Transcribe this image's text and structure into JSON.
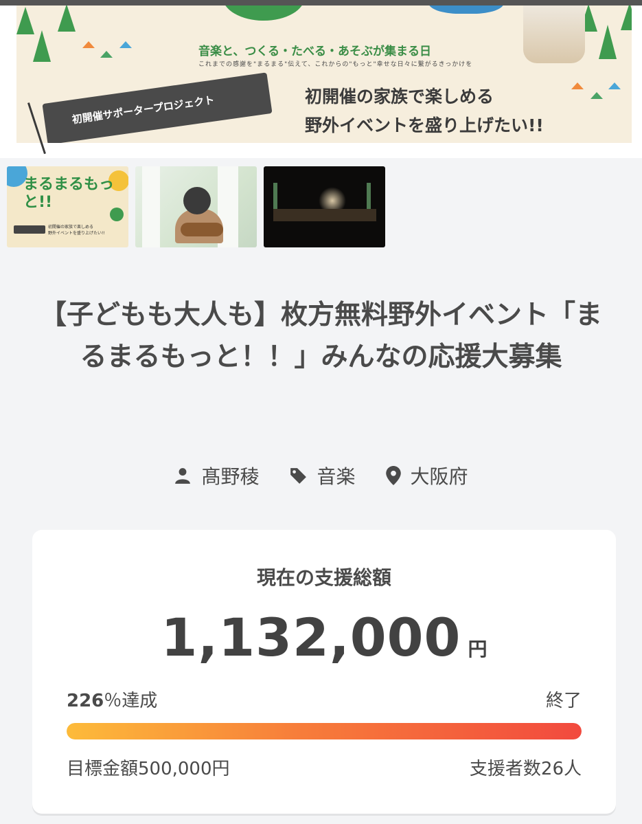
{
  "hero": {
    "tagline": "音楽と、つくる・たべる・あそぶが集まる日",
    "subline": "これまでの感謝を\"まるまる\"伝えて、これからの\"もっと\"幸せな日々に繋がるきっかけを",
    "ribbon": "初開催サポータープロジェクト",
    "headline_line1": "初開催の家族で楽しめる",
    "headline_line2": "野外イベントを盛り上げたい!!"
  },
  "thumbnails": [
    {
      "title": "まるまるもっと!!",
      "sub": "初開催の家族で楽しめる\n野外イベントを盛り上げたい!!"
    },
    {
      "title": ""
    },
    {
      "title": ""
    }
  ],
  "project": {
    "title": "【子どもも大人も】枚方無料野外イベント「まるまるもっと！！」みんなの応援大募集",
    "owner": "髙野稜",
    "category": "音楽",
    "location": "大阪府"
  },
  "funding": {
    "label": "現在の支援総額",
    "amount": "1,132,000",
    "currency": "円",
    "percent": "226",
    "percent_suffix": "％達成",
    "progress_fraction": 1.0,
    "status": "終了",
    "goal": "目標金額500,000円",
    "backers": "支援者数26人"
  },
  "colors": {
    "bar_start": "#fdbb3a",
    "bar_end": "#f24a3e",
    "card_bg": "#ffffff",
    "page_bg": "#f3f4f6"
  },
  "icons": {
    "owner": "person-icon",
    "category": "tag-icon",
    "location": "map-pin-icon"
  }
}
